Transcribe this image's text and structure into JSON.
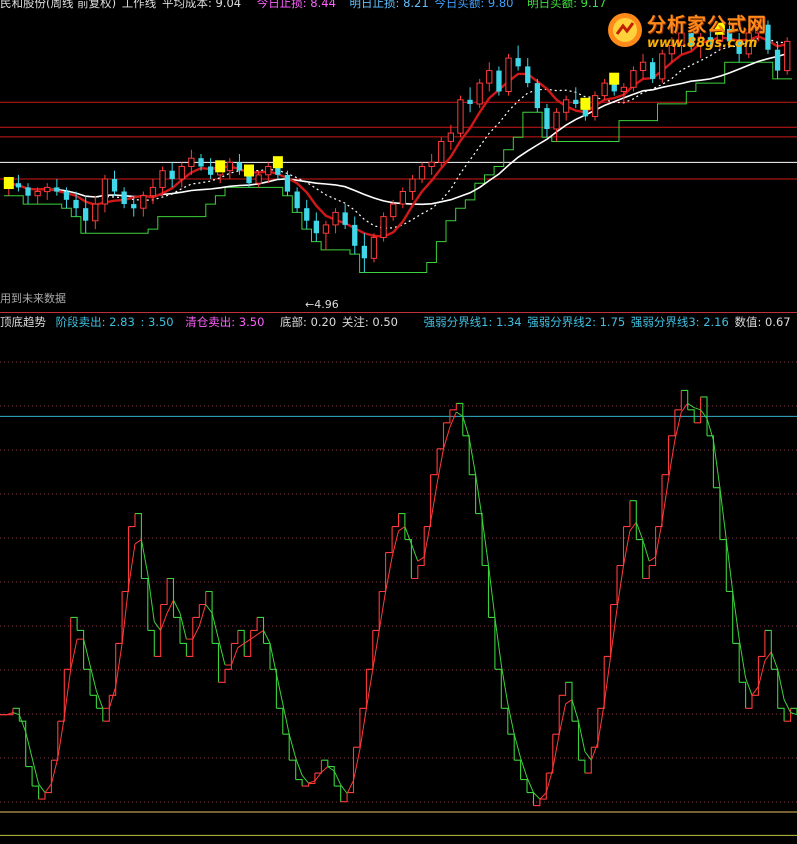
{
  "top_header": {
    "stock": "民和股份(周线 前复权)",
    "workline": "工作线",
    "avg_cost": "平均成本: 9.04",
    "today_stop": "今日止损: 8.44",
    "tomorrow_stop": "明日止损: 8.21",
    "today_buy": "今日买额: 9.80",
    "tomorrow_buy": "明日买额: 9.17"
  },
  "top_notes": {
    "future_data": "用到未来数据",
    "low_label": "←4.96"
  },
  "bottom_header": {
    "name": "顶底趋势",
    "stage_sell": "阶段卖出: 2.83",
    "stage_sell_b": ": 3.50",
    "clear_sell": "清仓卖出: 3.50",
    "bottom": "底部: 0.20",
    "watch": "关注: 0.50",
    "line1": "强弱分界线1: 1.34",
    "line2": "强弱分界线2: 1.75",
    "line3": "强弱分界线3: 2.16",
    "value": "数值: 0.67"
  },
  "logo": {
    "main": "分析家公式网",
    "url": "www.88gs.com"
  },
  "colors": {
    "up": "#ff3a3a",
    "down": "#40d8e8",
    "green": "#3cd23c",
    "white": "#ffffff",
    "darkred": "#d01818",
    "yellow": "#ffff00",
    "red_line": "#c0303a",
    "cyan_line": "#30b0c8",
    "orange_line": "#e8c060"
  },
  "chart_data": [
    {
      "type": "candlestick",
      "title": "民和股份(周线 前复权)",
      "ylim": [
        4.3,
        11.3
      ],
      "price_low_marker": 4.96,
      "horizontal_levels": [
        9.04,
        8.44,
        8.21,
        7.6,
        7.2
      ],
      "ohlc": [
        [
          7.0,
          7.2,
          6.8,
          7.1
        ],
        [
          7.1,
          7.3,
          6.9,
          7.0
        ],
        [
          7.0,
          7.1,
          6.6,
          6.8
        ],
        [
          6.8,
          7.0,
          6.6,
          6.9
        ],
        [
          6.9,
          7.1,
          6.7,
          7.0
        ],
        [
          7.0,
          7.2,
          6.8,
          6.9
        ],
        [
          6.9,
          7.0,
          6.5,
          6.7
        ],
        [
          6.7,
          6.9,
          6.3,
          6.5
        ],
        [
          6.5,
          6.8,
          5.9,
          6.2
        ],
        [
          6.2,
          6.8,
          6.0,
          6.6
        ],
        [
          6.6,
          7.3,
          6.4,
          7.2
        ],
        [
          7.2,
          7.4,
          6.8,
          6.9
        ],
        [
          6.9,
          7.0,
          6.5,
          6.6
        ],
        [
          6.6,
          6.8,
          6.3,
          6.5
        ],
        [
          6.5,
          6.9,
          6.3,
          6.8
        ],
        [
          6.8,
          7.2,
          6.6,
          7.0
        ],
        [
          7.0,
          7.5,
          6.8,
          7.4
        ],
        [
          7.4,
          7.6,
          7.0,
          7.2
        ],
        [
          7.2,
          7.6,
          7.0,
          7.5
        ],
        [
          7.5,
          7.9,
          7.3,
          7.7
        ],
        [
          7.7,
          7.8,
          7.4,
          7.5
        ],
        [
          7.5,
          7.7,
          7.2,
          7.3
        ],
        [
          7.3,
          7.6,
          7.1,
          7.4
        ],
        [
          7.4,
          7.7,
          7.2,
          7.6
        ],
        [
          7.6,
          7.8,
          7.3,
          7.4
        ],
        [
          7.4,
          7.5,
          7.0,
          7.1
        ],
        [
          7.1,
          7.4,
          7.0,
          7.3
        ],
        [
          7.3,
          7.6,
          7.1,
          7.5
        ],
        [
          7.5,
          7.7,
          7.2,
          7.3
        ],
        [
          7.3,
          7.4,
          6.8,
          6.9
        ],
        [
          6.9,
          7.0,
          6.4,
          6.5
        ],
        [
          6.5,
          6.7,
          6.0,
          6.2
        ],
        [
          6.2,
          6.4,
          5.7,
          5.9
        ],
        [
          5.9,
          6.2,
          5.5,
          6.1
        ],
        [
          6.1,
          6.5,
          5.9,
          6.4
        ],
        [
          6.4,
          6.6,
          6.0,
          6.1
        ],
        [
          6.1,
          6.3,
          5.4,
          5.6
        ],
        [
          5.6,
          5.9,
          4.96,
          5.3
        ],
        [
          5.3,
          5.9,
          5.2,
          5.8
        ],
        [
          5.8,
          6.4,
          5.7,
          6.3
        ],
        [
          6.3,
          6.7,
          6.2,
          6.6
        ],
        [
          6.6,
          7.0,
          6.5,
          6.9
        ],
        [
          6.9,
          7.3,
          6.7,
          7.2
        ],
        [
          7.2,
          7.6,
          7.1,
          7.5
        ],
        [
          7.5,
          7.8,
          7.3,
          7.6
        ],
        [
          7.6,
          8.2,
          7.5,
          8.1
        ],
        [
          8.1,
          8.5,
          7.9,
          8.3
        ],
        [
          8.3,
          9.2,
          8.2,
          9.1
        ],
        [
          9.1,
          9.4,
          8.8,
          9.0
        ],
        [
          9.0,
          9.6,
          8.9,
          9.5
        ],
        [
          9.5,
          10.0,
          9.3,
          9.8
        ],
        [
          9.8,
          9.9,
          9.2,
          9.3
        ],
        [
          9.3,
          10.2,
          9.2,
          10.1
        ],
        [
          10.1,
          10.4,
          9.8,
          9.9
        ],
        [
          9.9,
          10.1,
          9.4,
          9.5
        ],
        [
          9.5,
          9.6,
          8.8,
          8.9
        ],
        [
          8.9,
          9.0,
          8.2,
          8.4
        ],
        [
          8.4,
          8.9,
          8.1,
          8.8
        ],
        [
          8.8,
          9.2,
          8.6,
          9.1
        ],
        [
          9.1,
          9.4,
          8.9,
          9.0
        ],
        [
          9.0,
          9.1,
          8.6,
          8.7
        ],
        [
          8.7,
          9.3,
          8.6,
          9.2
        ],
        [
          9.2,
          9.6,
          9.1,
          9.5
        ],
        [
          9.5,
          9.7,
          9.2,
          9.3
        ],
        [
          9.3,
          9.5,
          9.0,
          9.4
        ],
        [
          9.4,
          9.9,
          9.3,
          9.8
        ],
        [
          9.8,
          10.2,
          9.6,
          10.0
        ],
        [
          10.0,
          10.1,
          9.5,
          9.6
        ],
        [
          9.6,
          10.3,
          9.5,
          10.2
        ],
        [
          10.2,
          10.6,
          10.0,
          10.4
        ],
        [
          10.4,
          10.9,
          10.2,
          10.7
        ],
        [
          10.7,
          10.8,
          10.3,
          10.4
        ],
        [
          10.4,
          10.7,
          10.1,
          10.6
        ],
        [
          10.6,
          10.8,
          10.3,
          10.5
        ],
        [
          10.5,
          10.9,
          10.3,
          10.8
        ],
        [
          10.8,
          11.0,
          10.4,
          10.5
        ],
        [
          10.5,
          10.7,
          10.0,
          10.2
        ],
        [
          10.2,
          10.8,
          10.1,
          10.7
        ],
        [
          10.7,
          11.0,
          10.5,
          10.9
        ],
        [
          10.9,
          11.0,
          10.2,
          10.3
        ],
        [
          10.3,
          10.5,
          9.6,
          9.8
        ],
        [
          9.8,
          10.6,
          9.7,
          10.5
        ]
      ]
    },
    {
      "type": "line",
      "title": "顶底趋势",
      "ylim": [
        0,
        3.9
      ],
      "levels": [
        0.2,
        0.5,
        1.34,
        1.75,
        2.16,
        2.83,
        3.5
      ],
      "values": [
        0.95,
        0.95,
        1.0,
        0.9,
        0.55,
        0.4,
        0.3,
        0.35,
        0.6,
        0.9,
        1.3,
        1.7,
        1.6,
        1.3,
        1.1,
        1.0,
        0.9,
        1.1,
        1.5,
        1.9,
        2.4,
        2.5,
        2.0,
        1.6,
        1.4,
        1.8,
        2.0,
        1.7,
        1.5,
        1.4,
        1.7,
        1.8,
        1.9,
        1.5,
        1.2,
        1.3,
        1.5,
        1.6,
        1.4,
        1.6,
        1.7,
        1.5,
        1.3,
        1.0,
        0.8,
        0.6,
        0.45,
        0.4,
        0.42,
        0.5,
        0.6,
        0.55,
        0.4,
        0.28,
        0.35,
        0.7,
        1.0,
        1.3,
        1.6,
        1.9,
        2.2,
        2.4,
        2.5,
        2.3,
        2.0,
        2.1,
        2.4,
        2.8,
        3.0,
        3.2,
        3.3,
        3.35,
        3.1,
        2.8,
        2.5,
        2.1,
        1.7,
        1.3,
        1.0,
        0.8,
        0.6,
        0.45,
        0.35,
        0.25,
        0.3,
        0.5,
        0.8,
        1.1,
        1.2,
        0.9,
        0.6,
        0.5,
        0.7,
        1.0,
        1.4,
        1.8,
        2.1,
        2.4,
        2.6,
        2.3,
        2.0,
        2.1,
        2.4,
        2.8,
        3.1,
        3.3,
        3.45,
        3.3,
        3.2,
        3.4,
        3.1,
        2.7,
        2.3,
        1.9,
        1.5,
        1.2,
        1.0,
        1.1,
        1.4,
        1.6,
        1.3,
        1.0,
        0.9,
        1.0,
        0.95
      ]
    }
  ]
}
